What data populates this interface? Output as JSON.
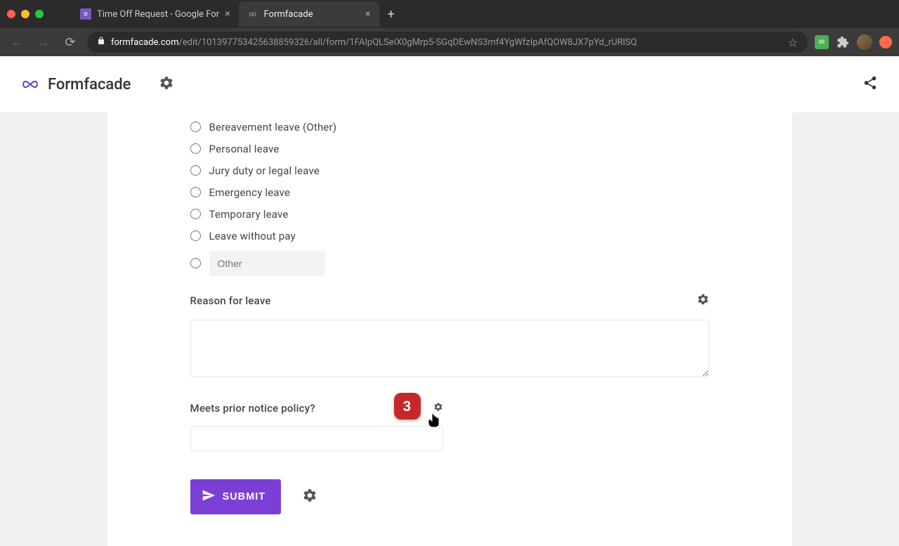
{
  "browser": {
    "tabs": [
      {
        "title": "Time Off Request - Google For",
        "active": false
      },
      {
        "title": "Formfacade",
        "active": true
      }
    ],
    "url_domain": "formfacade.com",
    "url_path": "/edit/101397753425638859326/all/form/1FAIpQLSeiX0gMrp5-SGqDEwNS3mf4YgWfzIpAfQOW8JX7pYd_rURlSQ"
  },
  "header": {
    "brand": "Formfacade"
  },
  "form": {
    "radios": [
      "Bereavement leave (Other)",
      "Personal leave",
      "Jury duty or legal leave",
      "Emergency leave",
      "Temporary leave",
      "Leave without pay"
    ],
    "other_placeholder": "Other",
    "reason_label": "Reason for leave",
    "policy_label": "Meets prior notice policy?",
    "submit_label": "SUBMIT",
    "annotation_number": "3"
  }
}
